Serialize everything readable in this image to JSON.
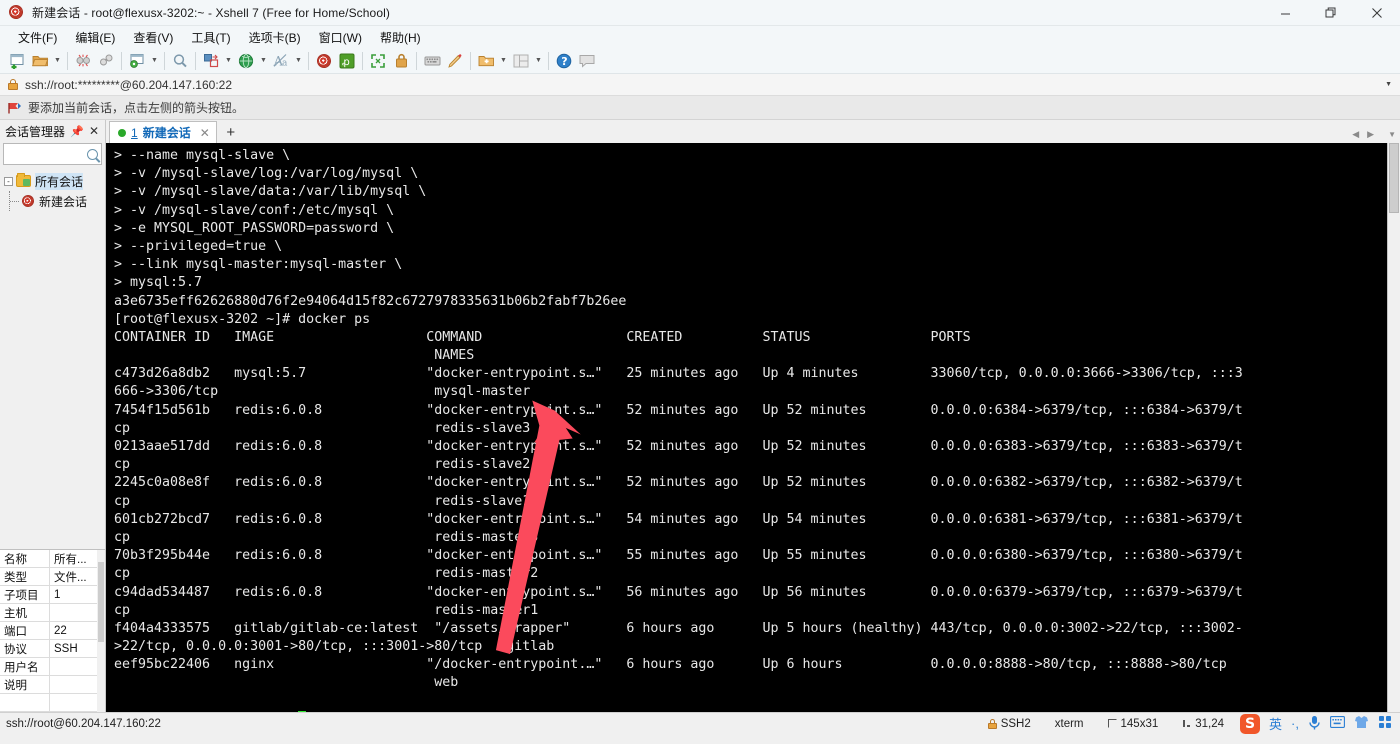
{
  "window": {
    "title": "新建会话 - root@flexusx-3202:~ - Xshell 7 (Free for Home/School)",
    "app_icon": "xshell-spiral-icon",
    "minimize_label": "—",
    "maximize_label": "❐",
    "close_label": "✕"
  },
  "menubar": {
    "items": [
      {
        "label": "文件(F)"
      },
      {
        "label": "编辑(E)"
      },
      {
        "label": "查看(V)"
      },
      {
        "label": "工具(T)"
      },
      {
        "label": "选项卡(B)"
      },
      {
        "label": "窗口(W)"
      },
      {
        "label": "帮助(H)"
      }
    ]
  },
  "toolbar": {
    "buttons": [
      {
        "name": "new-session-icon"
      },
      {
        "name": "open-folder-icon",
        "dropdown": true
      },
      {
        "name": "disconnect-icon"
      },
      {
        "name": "reconnect-icon"
      },
      {
        "name": "session-properties-icon",
        "dropdown": true
      },
      {
        "name": "find-icon"
      },
      {
        "name": "file-transfer-icon",
        "dropdown": true
      },
      {
        "name": "globe-icon",
        "dropdown": true
      },
      {
        "name": "font-size-icon",
        "dropdown": true
      },
      {
        "name": "xshell-icon"
      },
      {
        "name": "xftp-icon"
      },
      {
        "name": "fullscreen-icon"
      },
      {
        "name": "lock-icon"
      },
      {
        "name": "keyboard-icon"
      },
      {
        "name": "highlight-icon"
      },
      {
        "name": "new-folder-icon",
        "dropdown": true
      },
      {
        "name": "layout-icon",
        "dropdown": true
      },
      {
        "name": "help-icon"
      },
      {
        "name": "chat-icon"
      }
    ]
  },
  "address_bar": {
    "icon": "lock-icon",
    "value": "ssh://root:*********@60.204.147.160:22",
    "dropdown_icon": "chevron-down-icon"
  },
  "hint_bar": {
    "icon": "red-flag-icon",
    "text": "要添加当前会话，点击左侧的箭头按钮。"
  },
  "session_manager": {
    "title": "会话管理器",
    "pin_icon": "pin-icon",
    "close_icon": "close-icon",
    "search": {
      "placeholder": "",
      "value": "",
      "icon": "search-icon"
    },
    "tree": {
      "root": {
        "label": "所有会话",
        "icon": "folder-icon",
        "expanded": true,
        "toggle": "-"
      },
      "children": [
        {
          "label": "新建会话",
          "icon": "session-icon",
          "selected": true
        }
      ]
    },
    "properties": {
      "rows": [
        {
          "key": "名称",
          "value": "所有..."
        },
        {
          "key": "类型",
          "value": "文件..."
        },
        {
          "key": "子项目",
          "value": "1"
        },
        {
          "key": "主机",
          "value": ""
        },
        {
          "key": "端口",
          "value": "22"
        },
        {
          "key": "协议",
          "value": "SSH"
        },
        {
          "key": "用户名",
          "value": ""
        },
        {
          "key": "说明",
          "value": ""
        }
      ]
    }
  },
  "tabs": {
    "items": [
      {
        "status_dot": "#2aa92a",
        "number": "1",
        "label": "新建会话",
        "close_icon": "close-icon",
        "active": true
      }
    ],
    "add_label": "+",
    "nav_prev_icon": "chevron-left-icon",
    "nav_next_icon": "chevron-right-icon",
    "nav_menu_icon": "chevron-down-icon"
  },
  "terminal": {
    "lines": [
      "> --name mysql-slave \\",
      "> -v /mysql-slave/log:/var/log/mysql \\",
      "> -v /mysql-slave/data:/var/lib/mysql \\",
      "> -v /mysql-slave/conf:/etc/mysql \\",
      "> -e MYSQL_ROOT_PASSWORD=password \\",
      "> --privileged=true \\",
      "> --link mysql-master:mysql-master \\",
      "> mysql:5.7",
      "a3e6735eff62626880d76f2e94064d15f82c6727978335631b06b2fabf7b26ee",
      "[root@flexusx-3202 ~]# docker ps",
      "CONTAINER ID   IMAGE                   COMMAND                  CREATED          STATUS               PORTS",
      "                                        NAMES",
      "c473d26a8db2   mysql:5.7               \"docker-entrypoint.s…\"   25 minutes ago   Up 4 minutes         33060/tcp, 0.0.0.0:3666->3306/tcp, :::3",
      "666->3306/tcp                           mysql-master",
      "7454f15d561b   redis:6.0.8             \"docker-entrypoint.s…\"   52 minutes ago   Up 52 minutes        0.0.0.0:6384->6379/tcp, :::6384->6379/t",
      "cp                                      redis-slave3",
      "0213aae517dd   redis:6.0.8             \"docker-entrypoint.s…\"   52 minutes ago   Up 52 minutes        0.0.0.0:6383->6379/tcp, :::6383->6379/t",
      "cp                                      redis-slave2",
      "2245c0a08e8f   redis:6.0.8             \"docker-entrypoint.s…\"   52 minutes ago   Up 52 minutes        0.0.0.0:6382->6379/tcp, :::6382->6379/t",
      "cp                                      redis-slave1",
      "601cb272bcd7   redis:6.0.8             \"docker-entrypoint.s…\"   54 minutes ago   Up 54 minutes        0.0.0.0:6381->6379/tcp, :::6381->6379/t",
      "cp                                      redis-master3",
      "70b3f295b44e   redis:6.0.8             \"docker-entrypoint.s…\"   55 minutes ago   Up 55 minutes        0.0.0.0:6380->6379/tcp, :::6380->6379/t",
      "cp                                      redis-master2",
      "c94dad534487   redis:6.0.8             \"docker-entrypoint.s…\"   56 minutes ago   Up 56 minutes        0.0.0.0:6379->6379/tcp, :::6379->6379/t",
      "cp                                      redis-master1",
      "f404a4333575   gitlab/gitlab-ce:latest  \"/assets/wrapper\"       6 hours ago      Up 5 hours (healthy) 443/tcp, 0.0.0.0:3002->22/tcp, :::3002-",
      ">22/tcp, 0.0.0.0:3001->80/tcp, :::3001->80/tcp   gitlab",
      "eef95bc22406   nginx                   \"/docker-entrypoint.…\"   6 hours ago      Up 6 hours           0.0.0.0:8888->80/tcp, :::8888->80/tcp",
      "                                        web",
      ""
    ],
    "prompt": "[root@flexusx-3202 ~]# ",
    "cursor": "block",
    "cursor_color": "#2ee62e",
    "background": "#000000",
    "foreground": "#e8e8e8"
  },
  "annotation": {
    "type": "arrow",
    "color": "#fb4a5c",
    "description": "red arrow pointing up at COMMAND column"
  },
  "status_bar": {
    "left": "ssh://root@60.204.147.160:22",
    "protocol": "SSH2",
    "protocol_icon": "lock-icon",
    "terminal_type": "xterm",
    "size": "145x31",
    "size_icon": "terminal-size-icon",
    "cursor_pos": "31,24",
    "cursor_icon": "cursor-pos-icon",
    "ime": {
      "logo": "S",
      "items": [
        {
          "name": "language-mode",
          "glyph": "英"
        },
        {
          "name": "punctuation-mode",
          "glyph": "·,"
        },
        {
          "name": "voice-input-icon",
          "glyph": "🎤"
        },
        {
          "name": "soft-keyboard-icon",
          "glyph": "⌨"
        },
        {
          "name": "skin-icon",
          "glyph": "👕"
        },
        {
          "name": "toolbox-icon",
          "glyph": "▦"
        }
      ]
    }
  }
}
